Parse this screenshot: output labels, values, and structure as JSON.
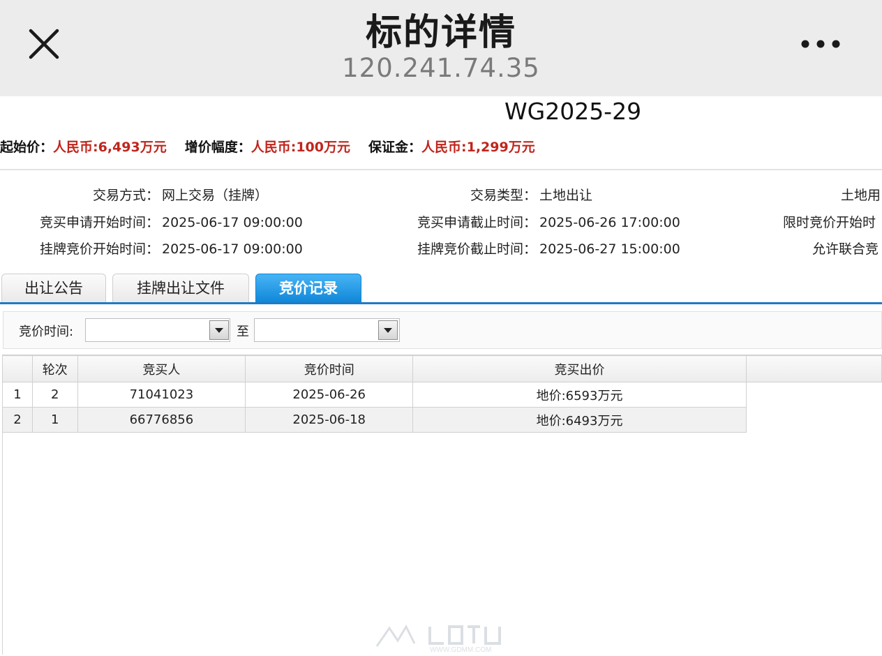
{
  "topbar": {
    "title": "标的详情",
    "subtitle": "120.241.74.35"
  },
  "header": {
    "code": "WG2025-29",
    "prices": [
      {
        "label": "起始价：",
        "value": "人民币:6,493万元"
      },
      {
        "label": "增价幅度：",
        "value": "人民币:100万元"
      },
      {
        "label": "保证金：",
        "value": "人民币:1,299万元"
      }
    ]
  },
  "properties": {
    "trade_mode": {
      "label": "交易方式：",
      "value": "网上交易（挂牌）"
    },
    "trade_type": {
      "label": "交易类型：",
      "value": "土地出让"
    },
    "land_use": {
      "label": "土地用",
      "value": ""
    },
    "apply_start": {
      "label": "竞买申请开始时间：",
      "value": "2025-06-17 09:00:00"
    },
    "apply_end": {
      "label": "竞买申请截止时间：",
      "value": "2025-06-26 17:00:00"
    },
    "timed_start": {
      "label": "限时竞价开始时",
      "value": ""
    },
    "listing_start": {
      "label": "挂牌竞价开始时间：",
      "value": "2025-06-17 09:00:00"
    },
    "listing_end": {
      "label": "挂牌竞价截止时间：",
      "value": "2025-06-27 15:00:00"
    },
    "joint_bid": {
      "label": "允许联合竞",
      "value": ""
    }
  },
  "tabs": [
    {
      "label": "出让公告"
    },
    {
      "label": "挂牌出让文件"
    },
    {
      "label": "竞价记录"
    }
  ],
  "filter": {
    "label": "竞价时间:",
    "separator": "至",
    "from_value": "",
    "to_value": ""
  },
  "table": {
    "headers": [
      "",
      "轮次",
      "竞买人",
      "竞价时间",
      "竞买出价"
    ],
    "rows": [
      [
        "1",
        "2",
        "71041023",
        "2025-06-26",
        "地价:6593万元"
      ],
      [
        "2",
        "1",
        "66776856",
        "2025-06-18",
        "地价:6493万元"
      ]
    ]
  },
  "watermark": {
    "text": "WWW.GDMM.COM"
  },
  "colors": {
    "accent": "#0f86d8",
    "price_red": "#c0251c",
    "topbar_bg": "#ececec"
  }
}
